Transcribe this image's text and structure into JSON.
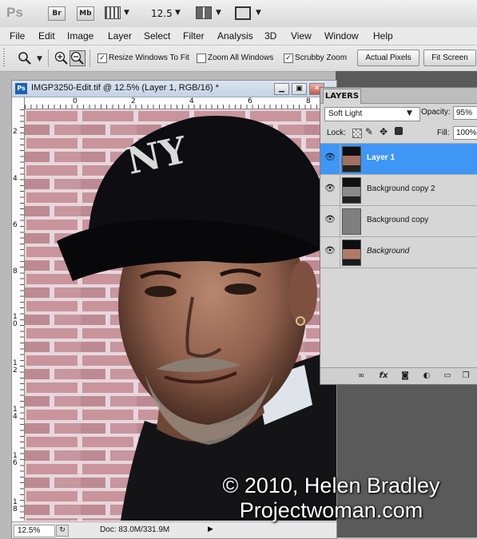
{
  "app": {
    "logo": "Ps",
    "bridge_label": "Br",
    "minibridge_label": "Mb",
    "zoom_level": "12.5"
  },
  "menu": [
    "File",
    "Edit",
    "Image",
    "Layer",
    "Select",
    "Filter",
    "Analysis",
    "3D",
    "View",
    "Window",
    "Help"
  ],
  "options": {
    "resize_windows": {
      "label": "Resize Windows To Fit",
      "checked": true
    },
    "zoom_all_windows": {
      "label": "Zoom All Windows",
      "checked": false
    },
    "scrubby_zoom": {
      "label": "Scrubby Zoom",
      "checked": true
    },
    "actual_pixels": "Actual Pixels",
    "fit_screen": "Fit Screen"
  },
  "document": {
    "title": "IMGP3250-Edit.tif @ 12.5% (Layer 1, RGB/16) *",
    "h_ruler_ticks": [
      "0",
      "2",
      "4",
      "6",
      "8"
    ],
    "v_ruler_ticks": [
      "2",
      "4",
      "6",
      "8",
      "1\n0",
      "1\n2",
      "1\n4",
      "1\n6",
      "1\n8"
    ],
    "zoom": "12.5%",
    "doc_size": "Doc: 83.0M/331.9M"
  },
  "layers_panel": {
    "tab": "LAYERS",
    "blend_mode": "Soft Light",
    "opacity_label": "Opacity:",
    "opacity": "95%",
    "lock_label": "Lock:",
    "fill_label": "Fill:",
    "fill": "100%",
    "layers": [
      {
        "name": "Layer 1",
        "selected": true,
        "visible": true
      },
      {
        "name": "Background copy 2",
        "selected": false,
        "visible": true
      },
      {
        "name": "Background copy",
        "selected": false,
        "visible": true
      },
      {
        "name": "Background",
        "selected": false,
        "visible": true
      }
    ]
  },
  "watermark": {
    "line1": "© 2010, Helen Bradley",
    "line2": "Projectwoman.com"
  },
  "colors": {
    "selection": "#3f96f4",
    "title_bar": "#c3d2e4",
    "workspace": "#5a5a5a"
  }
}
